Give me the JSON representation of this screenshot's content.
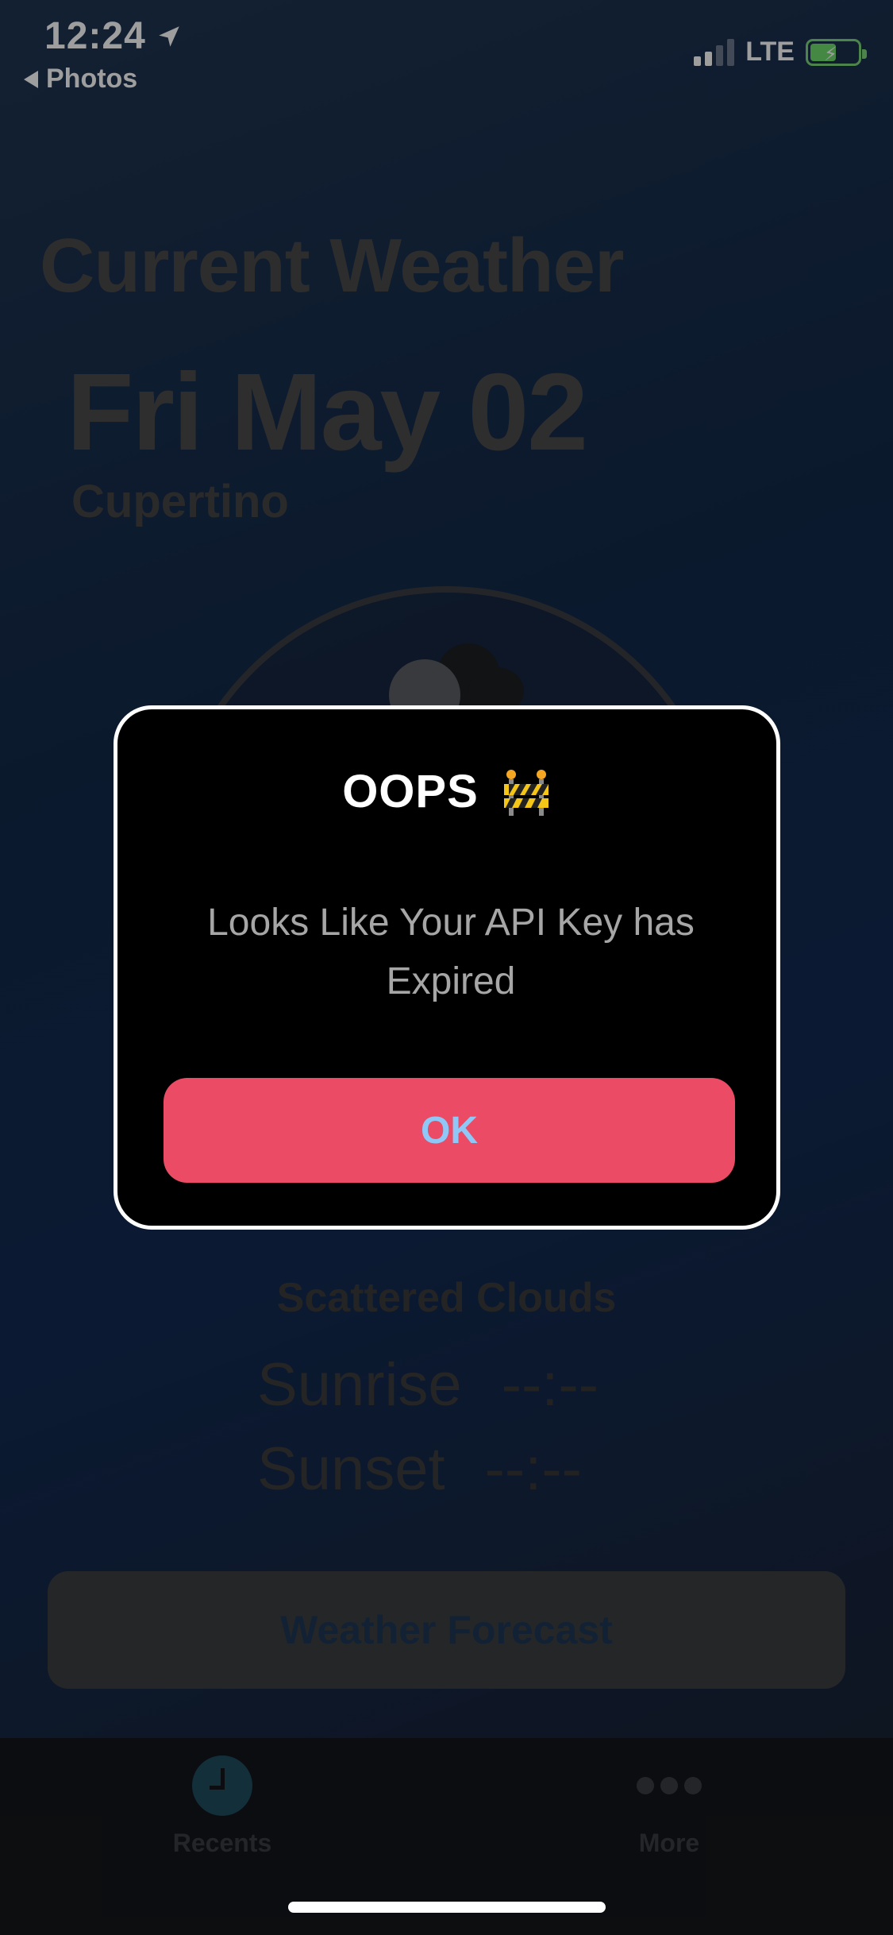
{
  "status_bar": {
    "time": "12:24",
    "back_app": "Photos",
    "network": "LTE",
    "location_icon": "location-arrow-icon",
    "battery_state": "charging"
  },
  "background": {
    "title": "Current Weather",
    "date": "Fri May 02",
    "city": "Cupertino",
    "description": "Scattered Clouds",
    "sunrise_label": "Sunrise",
    "sunrise_value": "--:--",
    "sunset_label": "Sunset",
    "sunset_value": "--:--",
    "forecast_button": "Weather Forecast",
    "weather_icon": "cloud-icon"
  },
  "tab_bar": {
    "items": [
      {
        "label": "Recents",
        "icon": "clock-icon"
      },
      {
        "label": "More",
        "icon": "ellipsis-icon"
      }
    ]
  },
  "alert": {
    "title": "OOPS",
    "title_icon": "construction-barrier-icon",
    "message": "Looks Like Your API Key has Expired",
    "ok_label": "OK"
  },
  "colors": {
    "alert_background": "#000000",
    "alert_border": "#ffffff",
    "button_background": "#eb4b65",
    "button_text": "#8fc8f7",
    "message_text": "#a6a6a6"
  }
}
